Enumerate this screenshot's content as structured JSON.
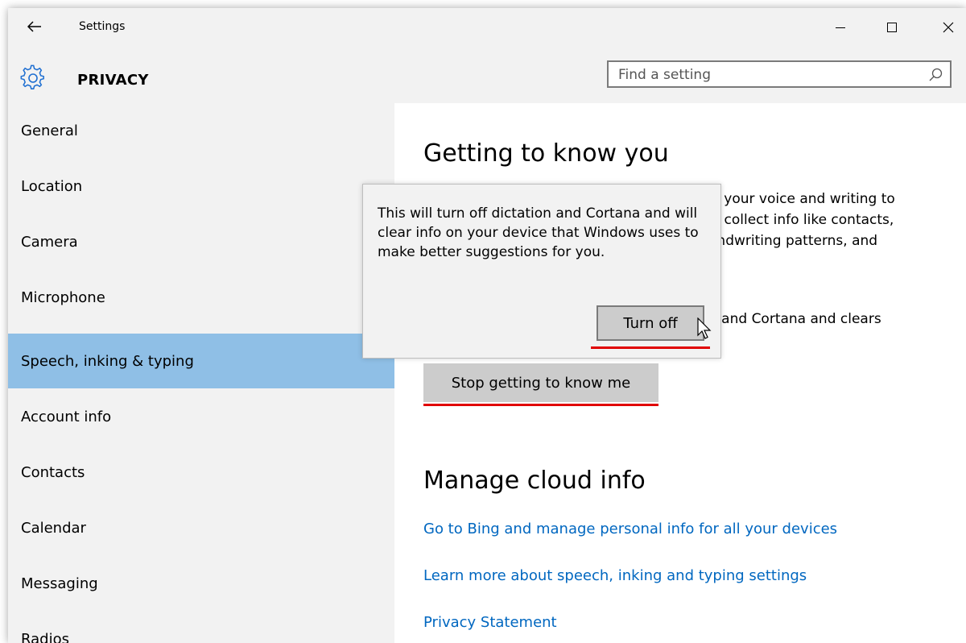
{
  "window": {
    "title": "Settings"
  },
  "header": {
    "section_title": "PRIVACY",
    "search_placeholder": "Find a setting"
  },
  "sidebar": {
    "items": [
      {
        "label": "General"
      },
      {
        "label": "Location"
      },
      {
        "label": "Camera"
      },
      {
        "label": "Microphone"
      },
      {
        "label": "Speech, inking & typing",
        "selected": true
      },
      {
        "label": "Account info"
      },
      {
        "label": "Contacts"
      },
      {
        "label": "Calendar"
      },
      {
        "label": "Messaging"
      },
      {
        "label": "Radios"
      }
    ]
  },
  "main": {
    "heading1": "Getting to know you",
    "partial_lines": [
      "w your voice and writing to",
      "'ll collect info like contacts,",
      "andwriting patterns, and"
    ],
    "partial_line2": "n and Cortana and clears",
    "stop_button": "Stop getting to know me",
    "heading2": "Manage cloud info",
    "links": [
      "Go to Bing and manage personal info for all your devices",
      "Learn more about speech, inking and typing settings",
      "Privacy Statement"
    ]
  },
  "popup": {
    "message": "This will turn off dictation and Cortana and will clear info on your device that Windows uses to make better suggestions for you.",
    "confirm_button": "Turn off"
  },
  "colors": {
    "accent_selected": "#8fbfe6",
    "link": "#0067c0",
    "annotation_underline": "#e00000",
    "chrome_bg": "#f2f2f2"
  },
  "icons": [
    "back-arrow-icon",
    "minimize-icon",
    "maximize-icon",
    "close-icon",
    "gear-icon",
    "search-icon",
    "mouse-cursor-icon"
  ]
}
